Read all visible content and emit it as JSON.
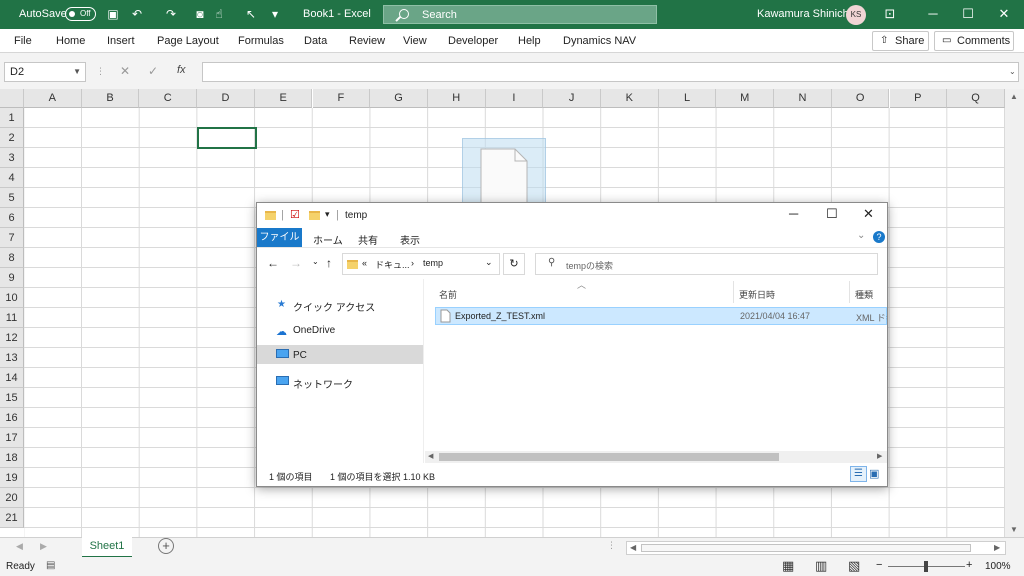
{
  "titlebar": {
    "autosave_label": "AutoSave",
    "autosave_state": "Off",
    "doc_title": "Book1  -  Excel",
    "search_placeholder": "Search",
    "user_name": "Kawamura Shinichi",
    "user_initials": "KS",
    "colors": {
      "bar": "#217346"
    }
  },
  "ribbon": {
    "tabs": [
      "File",
      "Home",
      "Insert",
      "Page Layout",
      "Formulas",
      "Data",
      "Review",
      "View",
      "Developer",
      "Help",
      "Dynamics NAV"
    ],
    "share_label": "Share",
    "comments_label": "Comments"
  },
  "formula_bar": {
    "name_box": "D2",
    "fx_label": "fx",
    "value": ""
  },
  "grid": {
    "columns": [
      "A",
      "B",
      "C",
      "D",
      "E",
      "F",
      "G",
      "H",
      "I",
      "J",
      "K",
      "L",
      "M",
      "N",
      "O",
      "P",
      "Q"
    ],
    "rows": [
      "1",
      "2",
      "3",
      "4",
      "5",
      "6",
      "7",
      "8",
      "9",
      "10",
      "11",
      "12",
      "13",
      "14",
      "15",
      "16",
      "17",
      "18",
      "19",
      "20",
      "21"
    ]
  },
  "sheets": {
    "tabs": [
      "Sheet1"
    ]
  },
  "status": {
    "ready": "Ready",
    "zoom": "100%"
  },
  "explorer": {
    "title": "temp",
    "ribbon_tabs": [
      "ファイル",
      "ホーム",
      "共有",
      "表示"
    ],
    "address_prefix": "«",
    "address_parent": "ドキュ...",
    "address_current": "temp",
    "search_placeholder": "tempの検索",
    "sidebar": [
      "クイック アクセス",
      "OneDrive",
      "PC",
      "ネットワーク"
    ],
    "columns": {
      "name": "名前",
      "date": "更新日時",
      "type": "種類"
    },
    "files": [
      {
        "name": "Exported_Z_TEST.xml",
        "date": "2021/04/04 16:47",
        "type": "XML ドキ"
      }
    ],
    "status_count": "1 個の項目",
    "status_selected": "1 個の項目を選択  1.10 KB"
  }
}
